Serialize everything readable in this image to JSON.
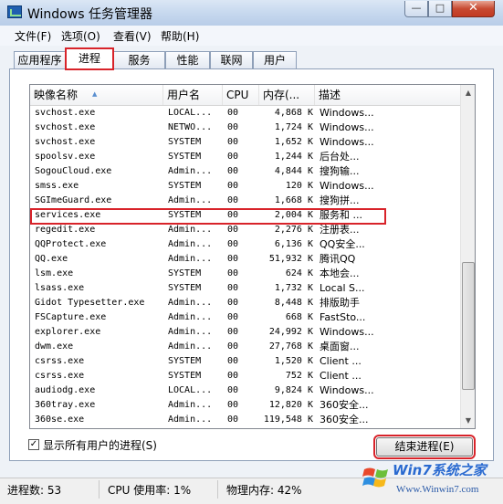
{
  "window": {
    "title": "Windows 任务管理器",
    "controls": {
      "minimize": "—",
      "maximize": "□",
      "close": "✕"
    }
  },
  "menu": [
    "文件(F)",
    "选项(O)",
    "查看(V)",
    "帮助(H)"
  ],
  "tabs": [
    {
      "label": "应用程序",
      "active": false
    },
    {
      "label": "进程",
      "active": true
    },
    {
      "label": "服务",
      "active": false
    },
    {
      "label": "性能",
      "active": false
    },
    {
      "label": "联网",
      "active": false
    },
    {
      "label": "用户",
      "active": false
    }
  ],
  "table": {
    "columns": [
      "映像名称",
      "用户名",
      "CPU",
      "内存(...",
      "描述"
    ],
    "selected_row": 7,
    "rows": [
      [
        "svchost.exe",
        "LOCAL...",
        "00",
        "4,868 K",
        "Windows..."
      ],
      [
        "svchost.exe",
        "NETWO...",
        "00",
        "1,724 K",
        "Windows..."
      ],
      [
        "svchost.exe",
        "SYSTEM",
        "00",
        "1,652 K",
        "Windows..."
      ],
      [
        "spoolsv.exe",
        "SYSTEM",
        "00",
        "1,244 K",
        "后台处..."
      ],
      [
        "SogouCloud.exe",
        "Admin...",
        "00",
        "4,844 K",
        "搜狗输..."
      ],
      [
        "smss.exe",
        "SYSTEM",
        "00",
        "120 K",
        "Windows..."
      ],
      [
        "SGImeGuard.exe",
        "Admin...",
        "00",
        "1,668 K",
        "搜狗拼..."
      ],
      [
        "services.exe",
        "SYSTEM",
        "00",
        "2,004 K",
        "服务和 ..."
      ],
      [
        "regedit.exe",
        "Admin...",
        "00",
        "2,276 K",
        "注册表..."
      ],
      [
        "QQProtect.exe",
        "Admin...",
        "00",
        "6,136 K",
        "QQ安全..."
      ],
      [
        "QQ.exe",
        "Admin...",
        "00",
        "51,932 K",
        "腾讯QQ"
      ],
      [
        "lsm.exe",
        "SYSTEM",
        "00",
        "624 K",
        "本地会..."
      ],
      [
        "lsass.exe",
        "SYSTEM",
        "00",
        "1,732 K",
        "Local S..."
      ],
      [
        "Gidot Typesetter.exe",
        "Admin...",
        "00",
        "8,448 K",
        "排版助手"
      ],
      [
        "FSCapture.exe",
        "Admin...",
        "00",
        "668 K",
        "FastSto..."
      ],
      [
        "explorer.exe",
        "Admin...",
        "00",
        "24,992 K",
        "Windows..."
      ],
      [
        "dwm.exe",
        "Admin...",
        "00",
        "27,768 K",
        "桌面窗..."
      ],
      [
        "csrss.exe",
        "SYSTEM",
        "00",
        "1,520 K",
        "Client ..."
      ],
      [
        "csrss.exe",
        "SYSTEM",
        "00",
        "752 K",
        "Client ..."
      ],
      [
        "audiodg.exe",
        "LOCAL...",
        "00",
        "9,824 K",
        "Windows..."
      ],
      [
        "360tray.exe",
        "Admin...",
        "00",
        "12,820 K",
        "360安全..."
      ],
      [
        "360se.exe",
        "Admin...",
        "00",
        "119,548 K",
        "360安全..."
      ]
    ]
  },
  "show_all_users": {
    "label": "显示所有用户的进程(S)",
    "checked": true
  },
  "end_process_label": "结束进程(E)",
  "status": {
    "processes": "进程数: 53",
    "cpu": "CPU 使用率: 1%",
    "memory": "物理内存: 42%"
  },
  "watermark": {
    "title": "Win7系统之家",
    "url": "Www.Winwin7.com"
  },
  "colors": {
    "highlight": "#d8232a",
    "title_bar": "#c5d7ee",
    "close": "#c74a32"
  }
}
